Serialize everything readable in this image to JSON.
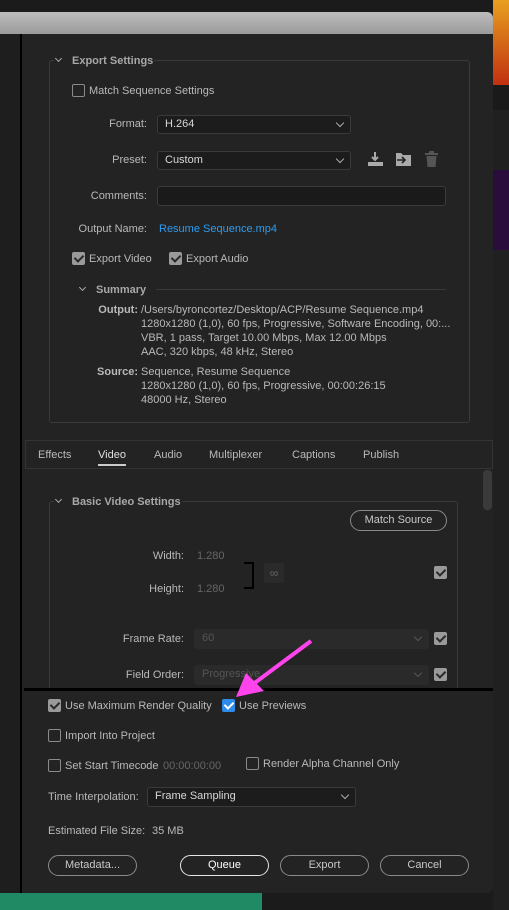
{
  "export_settings": {
    "title": "Export Settings",
    "match_sequence": {
      "label": "Match Sequence Settings",
      "checked": false
    },
    "format": {
      "label": "Format:",
      "value": "H.264"
    },
    "preset": {
      "label": "Preset:",
      "value": "Custom",
      "icons": [
        "save-preset-icon",
        "import-preset-icon",
        "delete-preset-icon"
      ]
    },
    "comments": {
      "label": "Comments:",
      "value": ""
    },
    "output_name": {
      "label": "Output Name:",
      "value": "Resume Sequence.mp4"
    },
    "export_video": {
      "label": "Export Video",
      "checked": true
    },
    "export_audio": {
      "label": "Export Audio",
      "checked": true
    },
    "summary": {
      "title": "Summary",
      "output_label": "Output:",
      "output_lines": [
        "/Users/byroncortez/Desktop/ACP/Resume Sequence.mp4",
        "1280x1280 (1,0), 60 fps, Progressive, Software Encoding, 00:...",
        "VBR, 1 pass, Target 10.00 Mbps, Max 12.00 Mbps",
        "AAC, 320 kbps, 48 kHz, Stereo"
      ],
      "source_label": "Source:",
      "source_lines": [
        "Sequence, Resume Sequence",
        "1280x1280 (1,0), 60 fps, Progressive, 00:00:26:15",
        "48000 Hz, Stereo"
      ]
    }
  },
  "tabs": {
    "active": "Video",
    "items": [
      "Effects",
      "Video",
      "Audio",
      "Multiplexer",
      "Captions",
      "Publish"
    ]
  },
  "video": {
    "title": "Basic Video Settings",
    "match_source": "Match Source",
    "width_label": "Width:",
    "width": "1.280",
    "height_label": "Height:",
    "height": "1.280",
    "frame_rate_label": "Frame Rate:",
    "frame_rate": "60",
    "field_order_label": "Field Order:",
    "field_order": "Progressive"
  },
  "bottom": {
    "max_render": {
      "label": "Use Maximum Render Quality",
      "checked": true
    },
    "use_previews": {
      "label": "Use Previews",
      "checked": true
    },
    "import_project": {
      "label": "Import Into Project",
      "checked": false
    },
    "start_timecode": {
      "label": "Set Start Timecode",
      "value": "00:00:00:00",
      "checked": false
    },
    "alpha_only": {
      "label": "Render Alpha Channel Only",
      "checked": false
    },
    "time_interp": {
      "label": "Time Interpolation:",
      "value": "Frame Sampling"
    },
    "file_size": {
      "label": "Estimated File Size:",
      "value": "35 MB"
    },
    "buttons": {
      "metadata": "Metadata...",
      "queue": "Queue",
      "export": "Export",
      "cancel": "Cancel"
    }
  },
  "colors": {
    "accent": "#2d8ceb",
    "link": "#2d9cf0",
    "annotation_arrow": "#ff44ee"
  }
}
